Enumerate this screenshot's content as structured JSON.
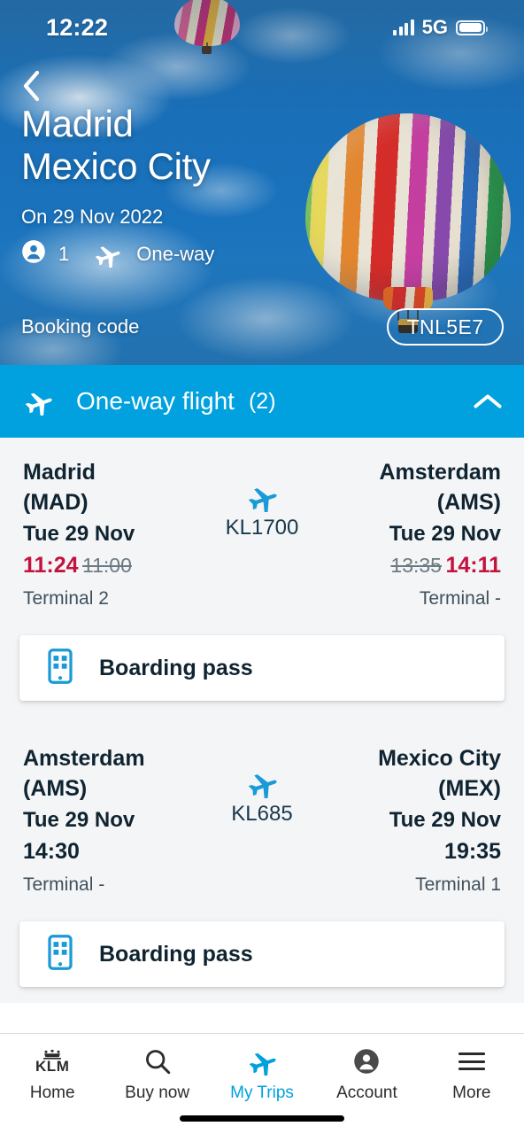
{
  "status_bar": {
    "time": "12:22",
    "network": "5G",
    "signal_icon": "signal-bars-icon",
    "battery_icon": "battery-icon"
  },
  "hero": {
    "back_icon": "chevron-left-icon",
    "origin_city": "Madrid",
    "destination_city": "Mexico City",
    "trip_date": "On 29 Nov 2022",
    "passenger_icon": "person-icon",
    "passenger_count": "1",
    "trip_type_icon": "plane-icon",
    "trip_type": "One-way",
    "booking_label": "Booking code",
    "booking_code": "TNL5E7"
  },
  "section": {
    "icon": "plane-icon",
    "title": "One-way flight",
    "count": "(2)",
    "collapse_icon": "chevron-up-icon"
  },
  "flights": [
    {
      "departure": {
        "city": "Madrid",
        "code": "(MAD)",
        "date": "Tue 29 Nov",
        "time_new": "11:24",
        "time_old": "11:00",
        "terminal": "Terminal 2"
      },
      "arrival": {
        "city": "Amsterdam",
        "code": "(AMS)",
        "date": "Tue 29 Nov",
        "time_new": "14:11",
        "time_old": "13:35",
        "terminal": "Terminal -"
      },
      "flight_number": "KL1700",
      "plane_icon": "plane-icon",
      "boarding_pass": {
        "icon": "mobile-boarding-pass-icon",
        "label": "Boarding pass"
      }
    },
    {
      "departure": {
        "city": "Amsterdam",
        "code": "(AMS)",
        "date": "Tue 29 Nov",
        "time": "14:30",
        "terminal": "Terminal -"
      },
      "arrival": {
        "city": "Mexico City",
        "code": "(MEX)",
        "date": "Tue 29 Nov",
        "time": "19:35",
        "terminal": "Terminal 1"
      },
      "flight_number": "KL685",
      "plane_icon": "plane-icon",
      "boarding_pass": {
        "icon": "mobile-boarding-pass-icon",
        "label": "Boarding pass"
      }
    }
  ],
  "bottom_nav": {
    "items": [
      {
        "label": "Home",
        "icon": "klm-crown-logo-icon",
        "active": false
      },
      {
        "label": "Buy now",
        "icon": "search-icon",
        "active": false
      },
      {
        "label": "My Trips",
        "icon": "plane-icon",
        "active": true
      },
      {
        "label": "Account",
        "icon": "person-circle-icon",
        "active": false
      },
      {
        "label": "More",
        "icon": "hamburger-menu-icon",
        "active": false
      }
    ],
    "klm_wordmark": "KLM"
  },
  "colors": {
    "accent_blue": "#00a1de",
    "alert_red": "#c4123f",
    "text_dark": "#0f2430",
    "muted_grey": "#6d7a82",
    "page_background": "#f4f5f7"
  }
}
